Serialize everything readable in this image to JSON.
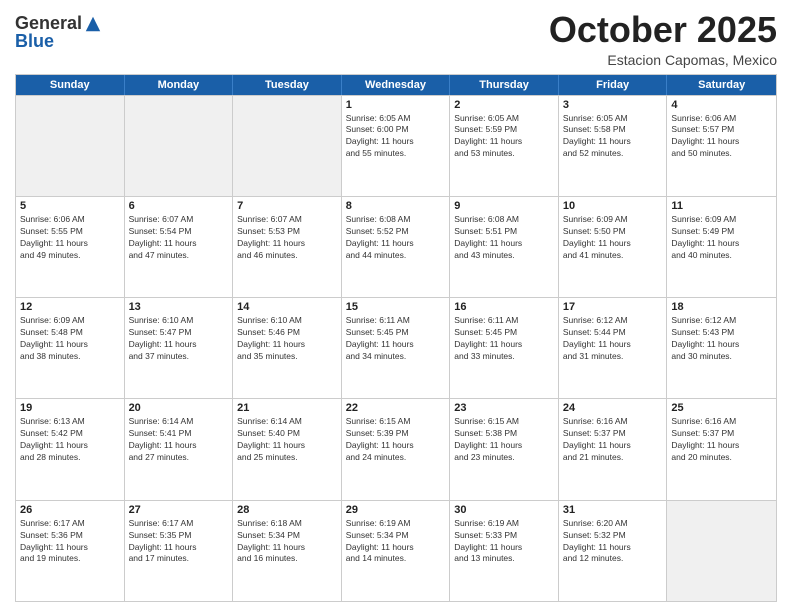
{
  "header": {
    "logo_general": "General",
    "logo_blue": "Blue",
    "month_title": "October 2025",
    "location": "Estacion Capomas, Mexico"
  },
  "days_of_week": [
    "Sunday",
    "Monday",
    "Tuesday",
    "Wednesday",
    "Thursday",
    "Friday",
    "Saturday"
  ],
  "weeks": [
    [
      {
        "day": "",
        "info": ""
      },
      {
        "day": "",
        "info": ""
      },
      {
        "day": "",
        "info": ""
      },
      {
        "day": "1",
        "info": "Sunrise: 6:05 AM\nSunset: 6:00 PM\nDaylight: 11 hours\nand 55 minutes."
      },
      {
        "day": "2",
        "info": "Sunrise: 6:05 AM\nSunset: 5:59 PM\nDaylight: 11 hours\nand 53 minutes."
      },
      {
        "day": "3",
        "info": "Sunrise: 6:05 AM\nSunset: 5:58 PM\nDaylight: 11 hours\nand 52 minutes."
      },
      {
        "day": "4",
        "info": "Sunrise: 6:06 AM\nSunset: 5:57 PM\nDaylight: 11 hours\nand 50 minutes."
      }
    ],
    [
      {
        "day": "5",
        "info": "Sunrise: 6:06 AM\nSunset: 5:55 PM\nDaylight: 11 hours\nand 49 minutes."
      },
      {
        "day": "6",
        "info": "Sunrise: 6:07 AM\nSunset: 5:54 PM\nDaylight: 11 hours\nand 47 minutes."
      },
      {
        "day": "7",
        "info": "Sunrise: 6:07 AM\nSunset: 5:53 PM\nDaylight: 11 hours\nand 46 minutes."
      },
      {
        "day": "8",
        "info": "Sunrise: 6:08 AM\nSunset: 5:52 PM\nDaylight: 11 hours\nand 44 minutes."
      },
      {
        "day": "9",
        "info": "Sunrise: 6:08 AM\nSunset: 5:51 PM\nDaylight: 11 hours\nand 43 minutes."
      },
      {
        "day": "10",
        "info": "Sunrise: 6:09 AM\nSunset: 5:50 PM\nDaylight: 11 hours\nand 41 minutes."
      },
      {
        "day": "11",
        "info": "Sunrise: 6:09 AM\nSunset: 5:49 PM\nDaylight: 11 hours\nand 40 minutes."
      }
    ],
    [
      {
        "day": "12",
        "info": "Sunrise: 6:09 AM\nSunset: 5:48 PM\nDaylight: 11 hours\nand 38 minutes."
      },
      {
        "day": "13",
        "info": "Sunrise: 6:10 AM\nSunset: 5:47 PM\nDaylight: 11 hours\nand 37 minutes."
      },
      {
        "day": "14",
        "info": "Sunrise: 6:10 AM\nSunset: 5:46 PM\nDaylight: 11 hours\nand 35 minutes."
      },
      {
        "day": "15",
        "info": "Sunrise: 6:11 AM\nSunset: 5:45 PM\nDaylight: 11 hours\nand 34 minutes."
      },
      {
        "day": "16",
        "info": "Sunrise: 6:11 AM\nSunset: 5:45 PM\nDaylight: 11 hours\nand 33 minutes."
      },
      {
        "day": "17",
        "info": "Sunrise: 6:12 AM\nSunset: 5:44 PM\nDaylight: 11 hours\nand 31 minutes."
      },
      {
        "day": "18",
        "info": "Sunrise: 6:12 AM\nSunset: 5:43 PM\nDaylight: 11 hours\nand 30 minutes."
      }
    ],
    [
      {
        "day": "19",
        "info": "Sunrise: 6:13 AM\nSunset: 5:42 PM\nDaylight: 11 hours\nand 28 minutes."
      },
      {
        "day": "20",
        "info": "Sunrise: 6:14 AM\nSunset: 5:41 PM\nDaylight: 11 hours\nand 27 minutes."
      },
      {
        "day": "21",
        "info": "Sunrise: 6:14 AM\nSunset: 5:40 PM\nDaylight: 11 hours\nand 25 minutes."
      },
      {
        "day": "22",
        "info": "Sunrise: 6:15 AM\nSunset: 5:39 PM\nDaylight: 11 hours\nand 24 minutes."
      },
      {
        "day": "23",
        "info": "Sunrise: 6:15 AM\nSunset: 5:38 PM\nDaylight: 11 hours\nand 23 minutes."
      },
      {
        "day": "24",
        "info": "Sunrise: 6:16 AM\nSunset: 5:37 PM\nDaylight: 11 hours\nand 21 minutes."
      },
      {
        "day": "25",
        "info": "Sunrise: 6:16 AM\nSunset: 5:37 PM\nDaylight: 11 hours\nand 20 minutes."
      }
    ],
    [
      {
        "day": "26",
        "info": "Sunrise: 6:17 AM\nSunset: 5:36 PM\nDaylight: 11 hours\nand 19 minutes."
      },
      {
        "day": "27",
        "info": "Sunrise: 6:17 AM\nSunset: 5:35 PM\nDaylight: 11 hours\nand 17 minutes."
      },
      {
        "day": "28",
        "info": "Sunrise: 6:18 AM\nSunset: 5:34 PM\nDaylight: 11 hours\nand 16 minutes."
      },
      {
        "day": "29",
        "info": "Sunrise: 6:19 AM\nSunset: 5:34 PM\nDaylight: 11 hours\nand 14 minutes."
      },
      {
        "day": "30",
        "info": "Sunrise: 6:19 AM\nSunset: 5:33 PM\nDaylight: 11 hours\nand 13 minutes."
      },
      {
        "day": "31",
        "info": "Sunrise: 6:20 AM\nSunset: 5:32 PM\nDaylight: 11 hours\nand 12 minutes."
      },
      {
        "day": "",
        "info": ""
      }
    ]
  ]
}
